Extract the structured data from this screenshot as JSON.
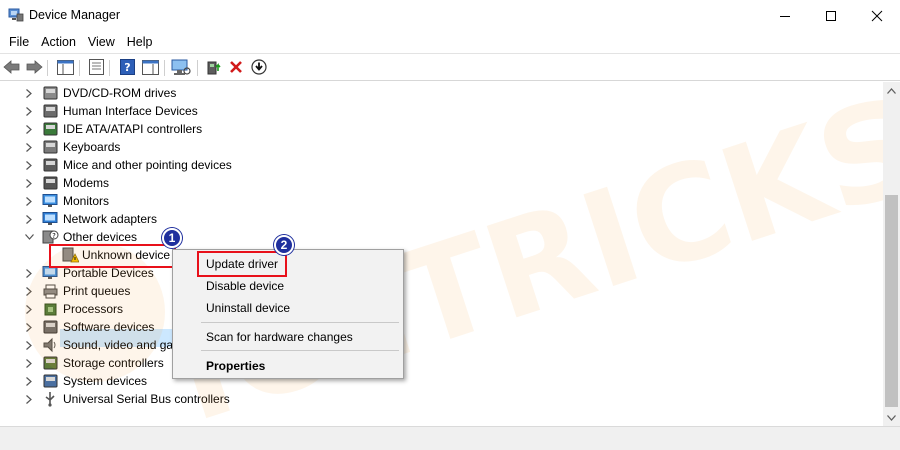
{
  "window": {
    "title": "Device Manager",
    "controls": {
      "minimize": "minimize",
      "maximize": "maximize",
      "close": "close"
    }
  },
  "menu": [
    "File",
    "Action",
    "View",
    "Help"
  ],
  "toolbar": {
    "icons": [
      "back-arrow-icon",
      "forward-arrow-icon",
      "show-hide-console-tree-icon",
      "properties-icon",
      "help-icon",
      "action-pane-icon",
      "scan-monitor-icon",
      "update-driver-icon",
      "uninstall-x-icon",
      "download-driver-icon"
    ]
  },
  "tree": {
    "items": [
      {
        "label": "DVD/CD-ROM drives",
        "icon": "dvd-drive-icon",
        "expanded": false
      },
      {
        "label": "Human Interface Devices",
        "icon": "hid-icon",
        "expanded": false
      },
      {
        "label": "IDE ATA/ATAPI controllers",
        "icon": "ide-controller-icon",
        "expanded": false
      },
      {
        "label": "Keyboards",
        "icon": "keyboard-icon",
        "expanded": false
      },
      {
        "label": "Mice and other pointing devices",
        "icon": "mouse-icon",
        "expanded": false
      },
      {
        "label": "Modems",
        "icon": "modem-icon",
        "expanded": false
      },
      {
        "label": "Monitors",
        "icon": "monitor-icon",
        "expanded": false
      },
      {
        "label": "Network adapters",
        "icon": "network-adapter-icon",
        "expanded": false
      },
      {
        "label": "Other devices",
        "icon": "other-devices-icon",
        "expanded": true
      },
      {
        "label": "Unknown device",
        "icon": "warning-device-icon",
        "child": true,
        "selected": true
      },
      {
        "label": "Portable Devices",
        "icon": "portable-device-icon",
        "expanded": false
      },
      {
        "label": "Print queues",
        "icon": "printer-icon",
        "expanded": false
      },
      {
        "label": "Processors",
        "icon": "processor-icon",
        "expanded": false
      },
      {
        "label": "Software devices",
        "icon": "software-device-icon",
        "expanded": false
      },
      {
        "label": "Sound, video and ga",
        "icon": "sound-icon",
        "expanded": false
      },
      {
        "label": "Storage controllers",
        "icon": "storage-controller-icon",
        "expanded": false
      },
      {
        "label": "System devices",
        "icon": "system-device-icon",
        "expanded": false
      },
      {
        "label": "Universal Serial Bus controllers",
        "icon": "usb-icon",
        "expanded": false
      }
    ]
  },
  "context_menu": {
    "items": [
      {
        "label": "Update driver",
        "bold": false
      },
      {
        "label": "Disable device",
        "bold": false
      },
      {
        "label": "Uninstall device",
        "bold": false
      },
      {
        "label": "Scan for hardware changes",
        "bold": false
      },
      {
        "label": "Properties",
        "bold": true
      }
    ]
  },
  "annotations": {
    "badge1": "1",
    "badge2": "2"
  },
  "watermark": {
    "text": "ICETRICKS",
    "color": "#f7a13a"
  },
  "colors": {
    "highlight_red": "#e8101a",
    "badge_blue": "#1f2f9e",
    "selection": "#cce8ff"
  }
}
